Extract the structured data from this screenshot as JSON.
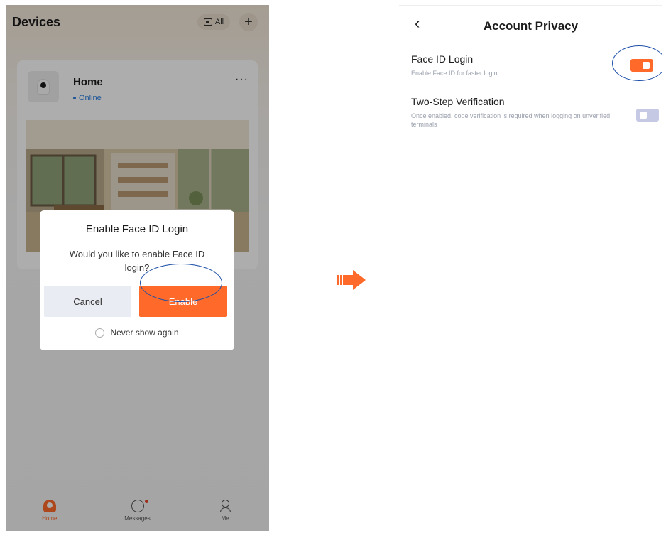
{
  "left_screen": {
    "header": {
      "title": "Devices",
      "all_label": "All"
    },
    "device": {
      "name": "Home",
      "status": "Online",
      "more_label": "···"
    },
    "dialog": {
      "title": "Enable Face ID Login",
      "message": "Would you like to enable Face ID login?",
      "cancel_label": "Cancel",
      "enable_label": "Enable",
      "never_show_label": "Never show again"
    },
    "tabbar": {
      "items": [
        {
          "label": "Home",
          "icon": "home-icon",
          "active": true
        },
        {
          "label": "Messages",
          "icon": "messages-icon",
          "active": false,
          "badge": true
        },
        {
          "label": "Me",
          "icon": "profile-icon",
          "active": false
        }
      ]
    }
  },
  "right_screen": {
    "back_label": "‹",
    "title": "Account Privacy",
    "settings": [
      {
        "title": "Face ID Login",
        "description": "Enable Face ID for faster login.",
        "enabled": true
      },
      {
        "title": "Two-Step Verification",
        "description": "Once enabled, code verification is required when logging on unverified terminals",
        "enabled": false
      }
    ]
  },
  "colors": {
    "accent": "#ff6a2b",
    "highlight_oval": "#1c4fa8",
    "status_online": "#2f7fe0",
    "toggle_off": "#c6c9e3"
  }
}
